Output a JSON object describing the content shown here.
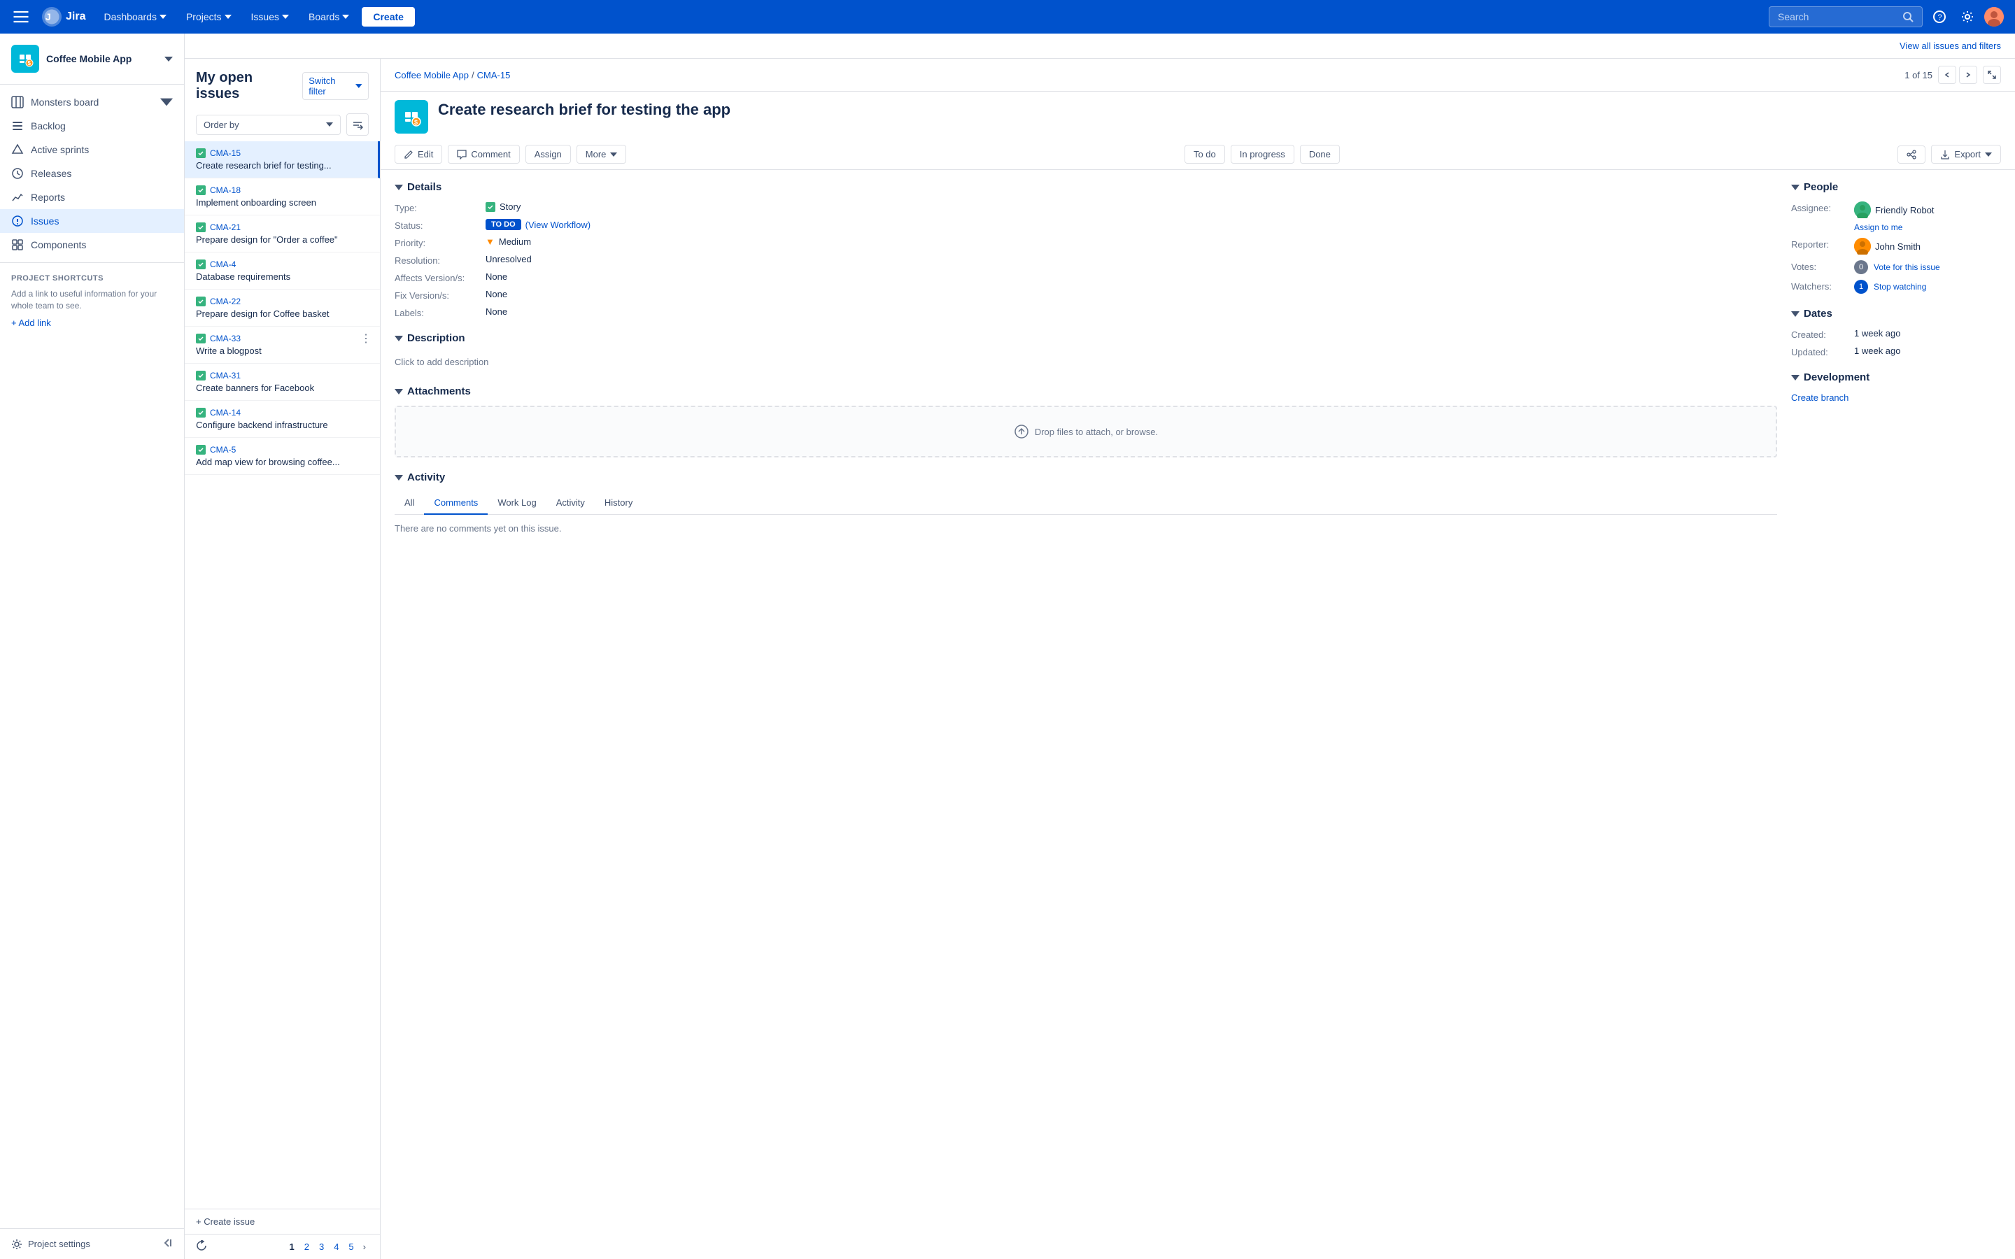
{
  "topnav": {
    "logo_text": "Jira",
    "dashboards_label": "Dashboards",
    "projects_label": "Projects",
    "issues_label": "Issues",
    "boards_label": "Boards",
    "create_label": "Create",
    "search_placeholder": "Search",
    "view_all_label": "View all issues and filters"
  },
  "sidebar": {
    "project_name": "Coffee Mobile App",
    "nav_items": [
      {
        "id": "monsters-board",
        "label": "Monsters board",
        "icon": "board-icon",
        "has_chevron": true
      },
      {
        "id": "backlog",
        "label": "Backlog",
        "icon": "backlog-icon"
      },
      {
        "id": "active-sprints",
        "label": "Active sprints",
        "icon": "sprint-icon"
      },
      {
        "id": "releases",
        "label": "Releases",
        "icon": "releases-icon"
      },
      {
        "id": "reports",
        "label": "Reports",
        "icon": "reports-icon"
      },
      {
        "id": "issues",
        "label": "Issues",
        "icon": "issues-icon",
        "active": true
      },
      {
        "id": "components",
        "label": "Components",
        "icon": "components-icon"
      }
    ],
    "shortcuts_title": "PROJECT SHORTCUTS",
    "shortcuts_desc": "Add a link to useful information for your whole team to see.",
    "add_link_label": "+ Add link",
    "settings_label": "Project settings"
  },
  "issues_panel": {
    "title": "My open issues",
    "switch_filter_label": "Switch filter",
    "order_by_label": "Order by",
    "issues": [
      {
        "id": "CMA-15",
        "title": "Create research brief for testing...",
        "selected": true
      },
      {
        "id": "CMA-18",
        "title": "Implement onboarding screen",
        "selected": false
      },
      {
        "id": "CMA-21",
        "title": "Prepare design for \"Order a coffee\"",
        "selected": false
      },
      {
        "id": "CMA-4",
        "title": "Database requirements",
        "selected": false
      },
      {
        "id": "CMA-22",
        "title": "Prepare design for Coffee basket",
        "selected": false
      },
      {
        "id": "CMA-33",
        "title": "Write a blogpost",
        "selected": false
      },
      {
        "id": "CMA-31",
        "title": "Create banners for Facebook",
        "selected": false
      },
      {
        "id": "CMA-14",
        "title": "Configure backend infrastructure",
        "selected": false
      },
      {
        "id": "CMA-5",
        "title": "Add map view for browsing coffee...",
        "selected": false
      }
    ],
    "create_issue_label": "+ Create issue",
    "pagination": {
      "current": "1",
      "pages": [
        "1",
        "2",
        "3",
        "4",
        "5"
      ]
    }
  },
  "detail": {
    "breadcrumb_project": "Coffee Mobile App",
    "breadcrumb_issue": "CMA-15",
    "nav_count": "1 of 15",
    "title": "Create research brief for testing the app",
    "actions": {
      "edit_label": "Edit",
      "comment_label": "Comment",
      "assign_label": "Assign",
      "more_label": "More",
      "todo_label": "To do",
      "in_progress_label": "In progress",
      "done_label": "Done",
      "share_label": "Share",
      "export_label": "Export"
    },
    "details_section_label": "Details",
    "fields": {
      "type_label": "Type:",
      "type_value": "Story",
      "status_label": "Status:",
      "status_value": "TO DO",
      "status_workflow": "(View Workflow)",
      "priority_label": "Priority:",
      "priority_value": "Medium",
      "resolution_label": "Resolution:",
      "resolution_value": "Unresolved",
      "affects_label": "Affects Version/s:",
      "affects_value": "None",
      "fix_label": "Fix Version/s:",
      "fix_value": "None",
      "labels_label": "Labels:",
      "labels_value": "None"
    },
    "people_section_label": "People",
    "people": {
      "assignee_label": "Assignee:",
      "assignee_name": "Friendly Robot",
      "assign_to_me": "Assign to me",
      "reporter_label": "Reporter:",
      "reporter_name": "John Smith",
      "votes_label": "Votes:",
      "votes_count": "0",
      "vote_link": "Vote for this issue",
      "watchers_label": "Watchers:",
      "watchers_count": "1",
      "stop_watching": "Stop watching"
    },
    "description_section_label": "Description",
    "description_placeholder": "Click to add description",
    "attachments_section_label": "Attachments",
    "drop_zone_text": "Drop files to attach, or browse.",
    "activity_section_label": "Activity",
    "activity_tabs": [
      "All",
      "Comments",
      "Work Log",
      "Activity",
      "History"
    ],
    "active_tab": "Comments",
    "activity_empty": "There are no comments yet on this issue.",
    "dates_section_label": "Dates",
    "dates": {
      "created_label": "Created:",
      "created_value": "1 week ago",
      "updated_label": "Updated:",
      "updated_value": "1 week ago"
    },
    "development_section_label": "Development",
    "create_branch_label": "Create branch"
  }
}
